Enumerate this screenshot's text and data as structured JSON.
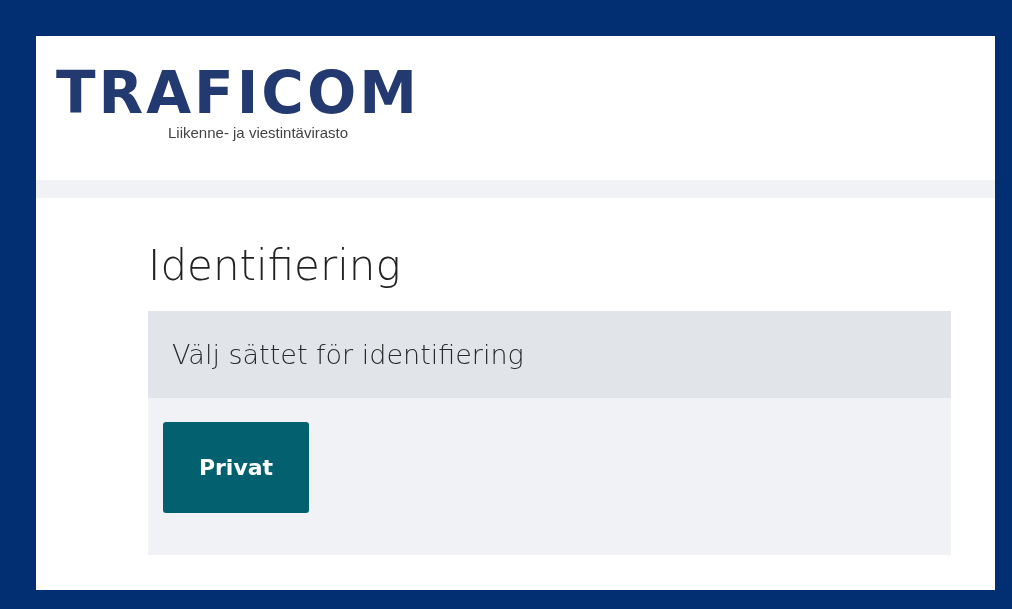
{
  "logo": {
    "wordmark": "TRAFICOM",
    "tagline": "Liikenne- ja viestintävirasto"
  },
  "heading": "Identifiering",
  "panel": {
    "title": "Välj sättet för identifiering",
    "buttons": [
      {
        "label": "Privat"
      }
    ]
  }
}
